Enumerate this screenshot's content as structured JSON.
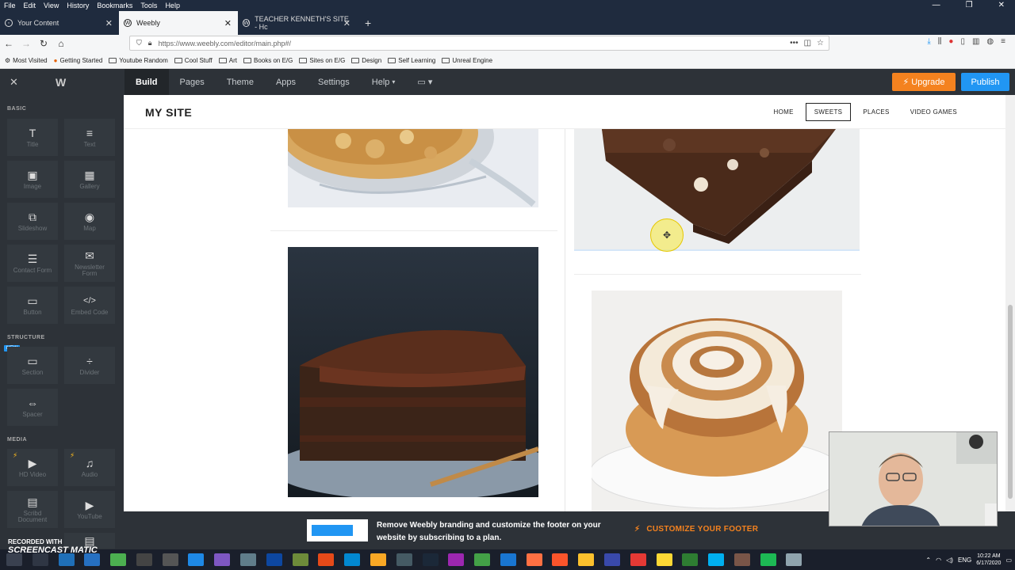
{
  "browser": {
    "menu": [
      "File",
      "Edit",
      "View",
      "History",
      "Bookmarks",
      "Tools",
      "Help"
    ],
    "tabs": [
      {
        "label": "Your Content",
        "active": false
      },
      {
        "label": "Weebly",
        "active": true
      },
      {
        "label": "TEACHER KENNETH'S SITE - Hc",
        "active": false
      }
    ],
    "url": "https://www.weebly.com/editor/main.php#/",
    "bookmarks": [
      "Most Visited",
      "Getting Started",
      "Youtube Random",
      "Cool Stuff",
      "Art",
      "Books on E/G",
      "Sites on E/G",
      "Design",
      "Self Learning",
      "Unreal Engine"
    ]
  },
  "editor": {
    "tabs": [
      "Build",
      "Pages",
      "Theme",
      "Apps",
      "Settings",
      "Help"
    ],
    "active_tab": "Build",
    "upgrade_label": "Upgrade",
    "publish_label": "Publish",
    "accent_upgrade": "#f4821f",
    "accent_publish": "#2196f3"
  },
  "sidebar": {
    "sections": {
      "basic": "BASIC",
      "structure": "STRUCTURE",
      "media": "MEDIA"
    },
    "new_badge": "NEW",
    "basic_items": [
      {
        "label": "Title",
        "icon": "T"
      },
      {
        "label": "Text",
        "icon": "≡"
      },
      {
        "label": "Image",
        "icon": "▣"
      },
      {
        "label": "Gallery",
        "icon": "▦"
      },
      {
        "label": "Slideshow",
        "icon": "⧉"
      },
      {
        "label": "Map",
        "icon": "◉"
      },
      {
        "label": "Contact Form",
        "icon": "☰"
      },
      {
        "label": "Newsletter Form",
        "icon": "✉"
      },
      {
        "label": "Button",
        "icon": "▭"
      },
      {
        "label": "Embed Code",
        "icon": "</>"
      }
    ],
    "structure_items": [
      {
        "label": "Section",
        "icon": "▭"
      },
      {
        "label": "Divider",
        "icon": "÷"
      },
      {
        "label": "Spacer",
        "icon": "⇔"
      }
    ],
    "media_items": [
      {
        "label": "HD Video",
        "icon": "▶"
      },
      {
        "label": "Audio",
        "icon": "♫"
      },
      {
        "label": "Scribd Document",
        "icon": "▤"
      },
      {
        "label": "YouTube",
        "icon": "▶"
      }
    ]
  },
  "site": {
    "title": "MY SITE",
    "nav": [
      "HOME",
      "SWEETS",
      "PLACES",
      "VIDEO GAMES"
    ],
    "active_nav": "SWEETS"
  },
  "footer_banner": {
    "text": "Remove Weebly branding and customize the footer on your website by subscribing to a plan.",
    "cta": "CUSTOMIZE YOUR FOOTER"
  },
  "watermark": {
    "line1": "RECORDED WITH",
    "line2": "SCREENCAST",
    "line3": "MATIC"
  },
  "taskbar": {
    "lang": "ENG",
    "time": "10:22 AM",
    "date": "6/17/2020"
  }
}
